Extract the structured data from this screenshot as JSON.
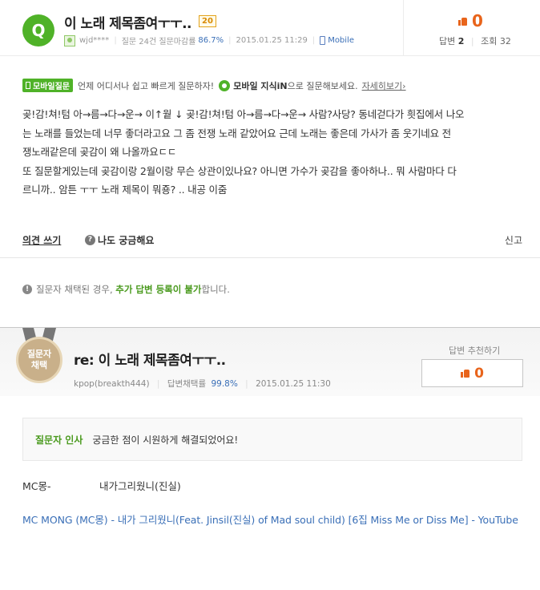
{
  "question": {
    "badge": "Q",
    "title": "이 노래 제목좀여ㅜㅜ..",
    "points": "20",
    "author": "wjd****",
    "question_count": "질문 24건",
    "close_rate_label": "질문마감률",
    "close_rate": "86.7%",
    "date": "2015.01.25 11:29",
    "device": "Mobile",
    "likes": "0",
    "answers_label": "답변",
    "answers": "2",
    "views_label": "조회",
    "views": "32",
    "body": [
      "곶!감!쳐!텀 아→름→다→운→ 이↑웥 ↓ 곶!감!쳐!텀 아→름→다→운→ 사람?사당? 동네걷다가 흿집에서 나오",
      "는 노래를 들었는데 너무 좋더라고요 그 좀 전쟁 노래 같았어요 근데  노래는 좋은데 가사가 좀 웃기네요 전",
      "쟁노래같은데 곶감이 왜 나올까요ㄷㄷ",
      "또 질문할게있는데 곶감이랑 2월이랑 무슨 상관이있나요? 아니면 가수가 곶감을 좋아하나.. 뭐 사람마다 다",
      "르니까.. 암튼 ㅜㅜ 노래 제목이 뭐죵? .. 내공 이줌"
    ],
    "opinion_link": "의견 쓰기",
    "curious_link": "나도 궁금해요",
    "report_link": "신고"
  },
  "mobile_banner": {
    "chip": "모바일질문",
    "text": "언제 어디서나 쉽고 빠르게 질문하자!",
    "app_name": "모바일 지식iN",
    "app_suffix": "으로 질문해보세요.",
    "more_link": "자세히보기›"
  },
  "notice": {
    "prefix": "질문자 채택된 경우,",
    "strong": "추가 답변 등록이 불가",
    "suffix": "합니다."
  },
  "answer": {
    "medal_line1": "질문자",
    "medal_line2": "채택",
    "title": "re: 이 노래 제목좀여ㅜㅜ..",
    "author": "kpop(breakth444)",
    "adopt_rate_label": "답변채택률",
    "adopt_rate": "99.8%",
    "date": "2015.01.25 11:30",
    "recommend_label": "답변 추천하기",
    "recommend_count": "0",
    "thanks_label": "질문자 인사",
    "thanks_msg": "궁금한 점이 시원하게 해결되었어요!",
    "artist": "MC몽-",
    "song": "내가그리웠니(진실)",
    "link_text": "MC MONG (MC몽) - 내가 그리웠니(Feat. Jinsil(진실) of Mad soul child) [6집 Miss Me or Diss Me] - YouTube"
  },
  "colors": {
    "brand_green": "#4fb228",
    "accent_orange": "#e8641b",
    "link_blue": "#3a6fb7"
  }
}
